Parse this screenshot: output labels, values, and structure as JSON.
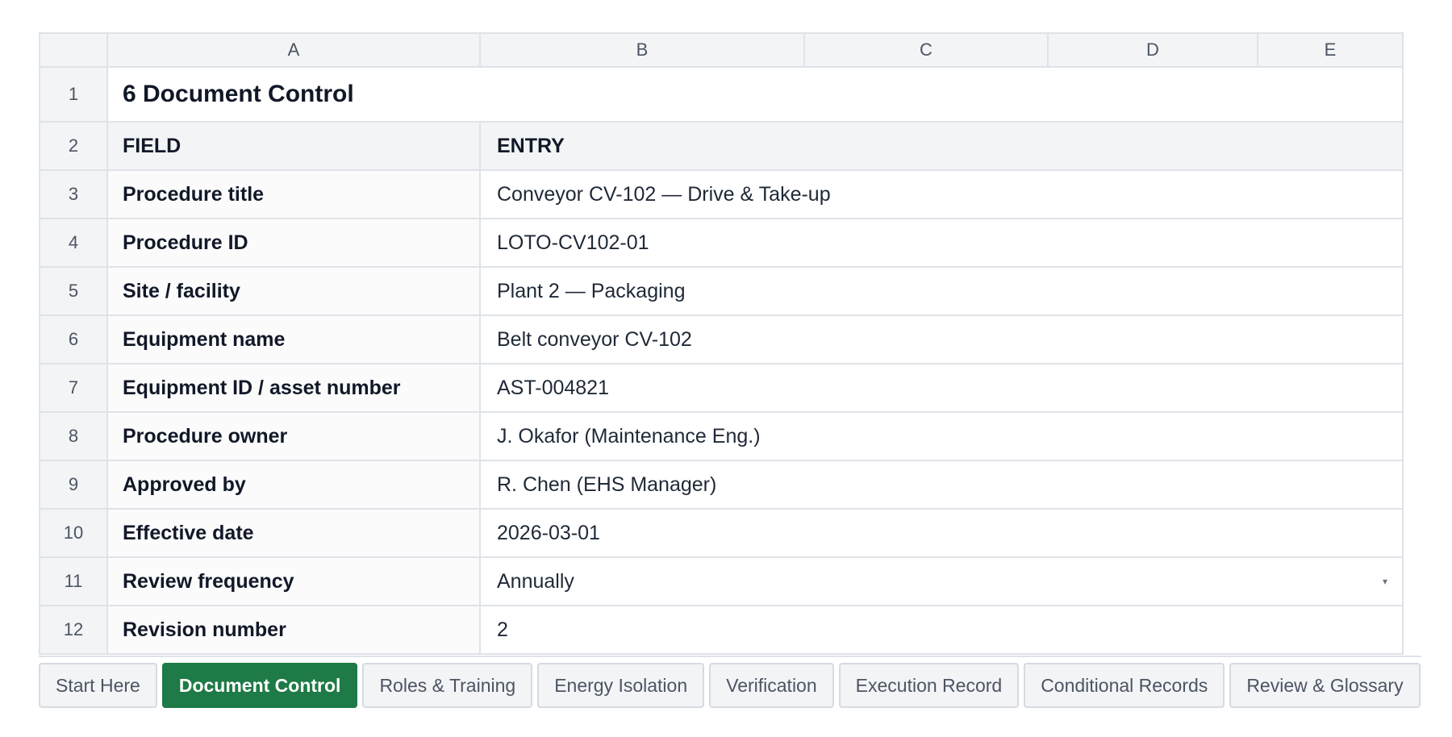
{
  "sheet": {
    "columns": [
      "A",
      "B",
      "C",
      "D",
      "E"
    ],
    "title": "6 Document Control",
    "header": {
      "field": "FIELD",
      "entry": "ENTRY"
    },
    "rows": [
      {
        "num": "3",
        "field": "Procedure title",
        "entry": "Conveyor CV-102 — Drive & Take-up"
      },
      {
        "num": "4",
        "field": "Procedure ID",
        "entry": "LOTO-CV102-01"
      },
      {
        "num": "5",
        "field": "Site / facility",
        "entry": "Plant 2 — Packaging"
      },
      {
        "num": "6",
        "field": "Equipment name",
        "entry": "Belt conveyor CV-102"
      },
      {
        "num": "7",
        "field": "Equipment ID / asset number",
        "entry": "AST-004821"
      },
      {
        "num": "8",
        "field": "Procedure owner",
        "entry": "J. Okafor (Maintenance Eng.)"
      },
      {
        "num": "9",
        "field": "Approved by",
        "entry": "R. Chen (EHS Manager)"
      },
      {
        "num": "10",
        "field": "Effective date",
        "entry": "2026-03-01"
      },
      {
        "num": "11",
        "field": "Review frequency",
        "entry": "Annually",
        "dropdown": true
      },
      {
        "num": "12",
        "field": "Revision number",
        "entry": "2"
      }
    ],
    "row_numbers": {
      "title": "1",
      "header": "2"
    }
  },
  "tabs": [
    {
      "label": "Start Here",
      "active": false
    },
    {
      "label": "Document Control",
      "active": true
    },
    {
      "label": "Roles & Training",
      "active": false
    },
    {
      "label": "Energy Isolation",
      "active": false
    },
    {
      "label": "Verification",
      "active": false
    },
    {
      "label": "Execution Record",
      "active": false
    },
    {
      "label": "Conditional Records",
      "active": false
    },
    {
      "label": "Review & Glossary",
      "active": false
    }
  ],
  "colors": {
    "active_tab": "#1e7a46",
    "grid": "#dfe3e8",
    "header_bg": "#f3f4f6"
  },
  "icons": {
    "dropdown": "dropdown-arrow-icon"
  }
}
